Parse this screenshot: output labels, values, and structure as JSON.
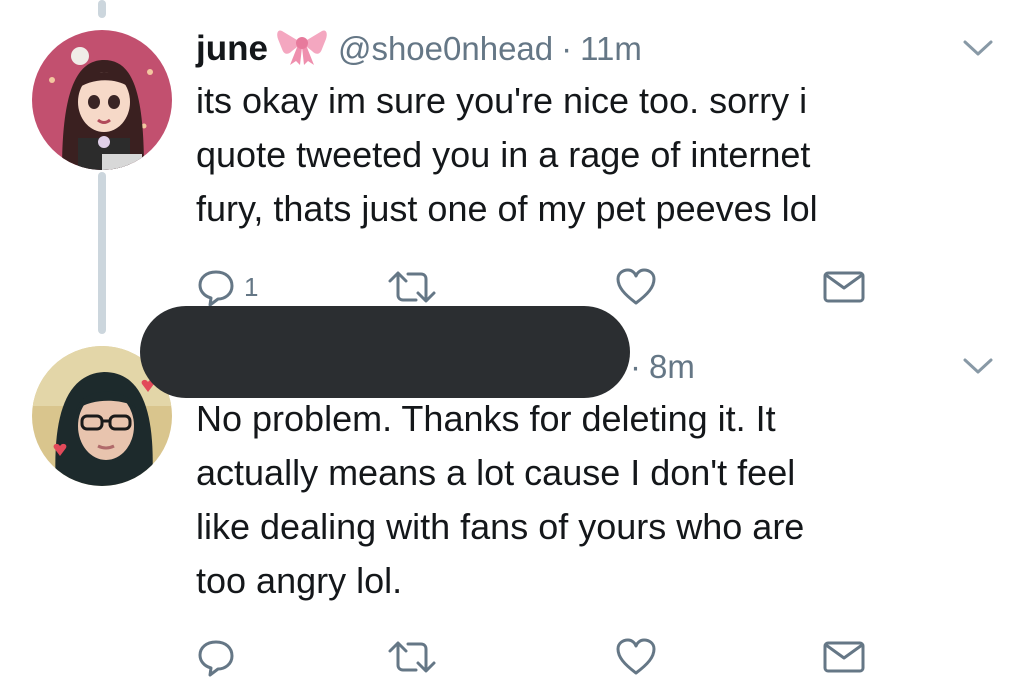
{
  "tweets": [
    {
      "display_name": "june",
      "handle": "@shoe0nhead",
      "separator": "·",
      "time": "11m",
      "text": "its okay im sure you're nice too. sorry i\nquote tweeted you in a rage of internet\nfury, thats just one of my pet peeves lol",
      "reply_count": "1"
    },
    {
      "display_name": "",
      "handle": "",
      "separator": "·",
      "time": "8m",
      "text": "No problem. Thanks for deleting it. It\nactually means a lot cause I don't feel\nlike dealing with fans of yours who are\ntoo angry lol.",
      "reply_count": ""
    }
  ],
  "icons": {
    "reply": "reply-icon",
    "retweet": "retweet-icon",
    "like": "heart-icon",
    "dm": "mail-icon",
    "menu": "chevron-down-icon",
    "name_emoji": "ribbon-icon"
  },
  "colors": {
    "text": "#14171a",
    "secondary": "#657786",
    "thread_line": "#ccd6dd",
    "redaction": "#2b2e31",
    "ribbon": "#f4a7c0"
  }
}
